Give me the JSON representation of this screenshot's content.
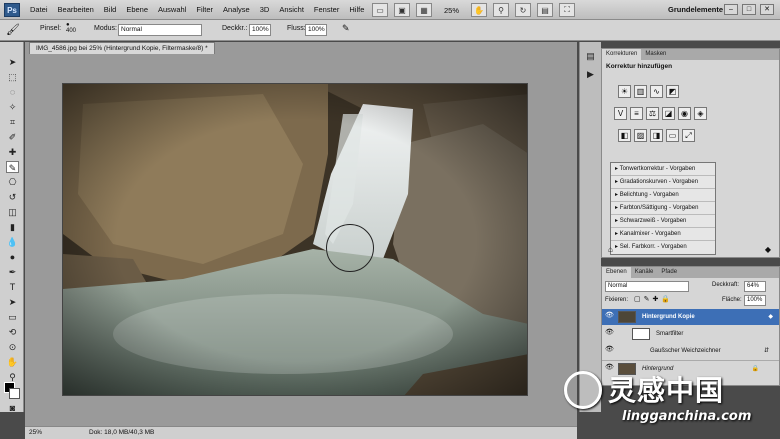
{
  "app": {
    "logo": "Ps",
    "workspace": "Grundelemente",
    "zoom": "25%"
  },
  "menu": [
    "Datei",
    "Bearbeiten",
    "Bild",
    "Ebene",
    "Auswahl",
    "Filter",
    "Analyse",
    "3D",
    "Ansicht",
    "Fenster",
    "Hilfe"
  ],
  "options": {
    "brush_label": "Pinsel:",
    "brush_size": "400",
    "mode_label": "Modus:",
    "mode_value": "Normal",
    "opacity_label": "Deckkr.:",
    "opacity_value": "100%",
    "flow_label": "Fluss:",
    "flow_value": "100%"
  },
  "document": {
    "tab_title": "IMG_4586.jpg bei 25% (Hintergrund Kopie, Filtermaske/8) *",
    "status_zoom": "25%",
    "status_doc": "Dok: 18,0 MB/40,3 MB"
  },
  "adjustments": {
    "tabs": [
      "Korrekturen",
      "Masken"
    ],
    "title": "Korrektur hinzufügen",
    "presets": [
      "Tonwertkorrektur - Vorgaben",
      "Gradationskurven - Vorgaben",
      "Belichtung - Vorgaben",
      "Farbton/Sättigung - Vorgaben",
      "Schwarzweiß - Vorgaben",
      "Kanalmixer - Vorgaben",
      "Sel. Farbkorr. - Vorgaben"
    ]
  },
  "layers": {
    "tabs": [
      "Ebenen",
      "Kanäle",
      "Pfade"
    ],
    "blend_mode": "Normal",
    "opacity_label": "Deckkraft:",
    "opacity_value": "64%",
    "lock_label": "Fixieren:",
    "fill_label": "Fläche:",
    "fill_value": "100%",
    "items": [
      {
        "name": "Hintergrund Kopie"
      },
      {
        "name": "Smartfilter"
      },
      {
        "name": "Gaußscher Weichzeichner"
      },
      {
        "name": "Hintergrund"
      }
    ]
  },
  "watermark": {
    "cn": "灵感中国",
    "en": "lingganchina.com"
  },
  "colors": {
    "accent": "#3d6fb6",
    "selected_layer": "#3d6fb6",
    "panel_bg": "#d6d6d6"
  }
}
